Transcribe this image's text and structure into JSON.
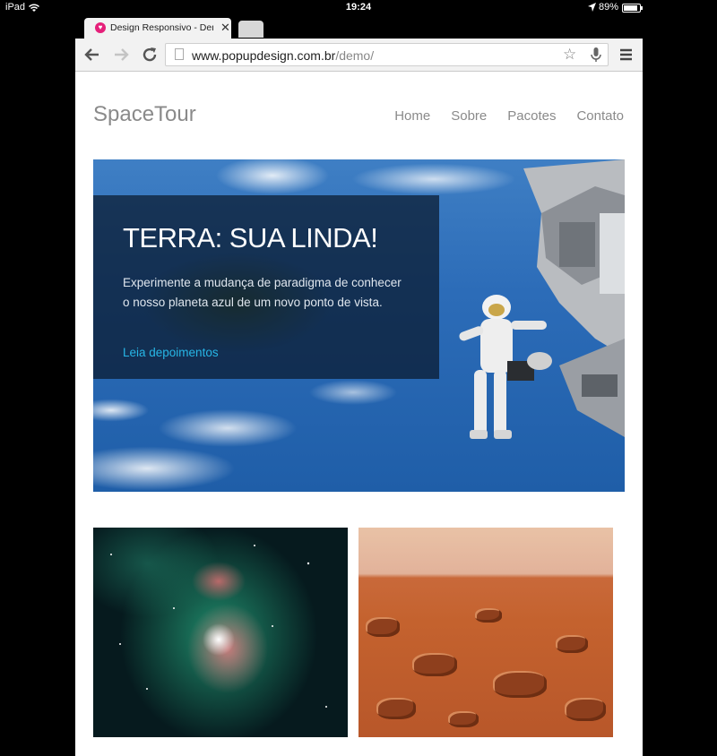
{
  "status_bar": {
    "device": "iPad",
    "time": "19:24",
    "battery_percent": "89%",
    "battery_level": 0.89
  },
  "browser": {
    "tab": {
      "title": "Design Responsivo - Demo",
      "favicon_color": "#e5207a"
    },
    "address_bar": {
      "domain": "www.popupdesign.com.br",
      "path": "/demo/"
    },
    "icons": {
      "back": "arrow-left-icon",
      "forward": "arrow-right-icon",
      "reload": "reload-icon",
      "bookmark": "star-icon",
      "voice": "microphone-icon",
      "menu": "hamburger-menu-icon"
    }
  },
  "site": {
    "logo": "SpaceTour",
    "nav": [
      "Home",
      "Sobre",
      "Pacotes",
      "Contato"
    ],
    "hero": {
      "title": "TERRA: SUA LINDA!",
      "text": "Experimente a mudança de paradigma de conhecer o nosso planeta azul de um novo ponto de vista.",
      "link": "Leia depoimentos"
    },
    "colors": {
      "text_gray": "#8a8a8a",
      "link": "#27b6e6",
      "overlay": "#0a192d"
    }
  }
}
